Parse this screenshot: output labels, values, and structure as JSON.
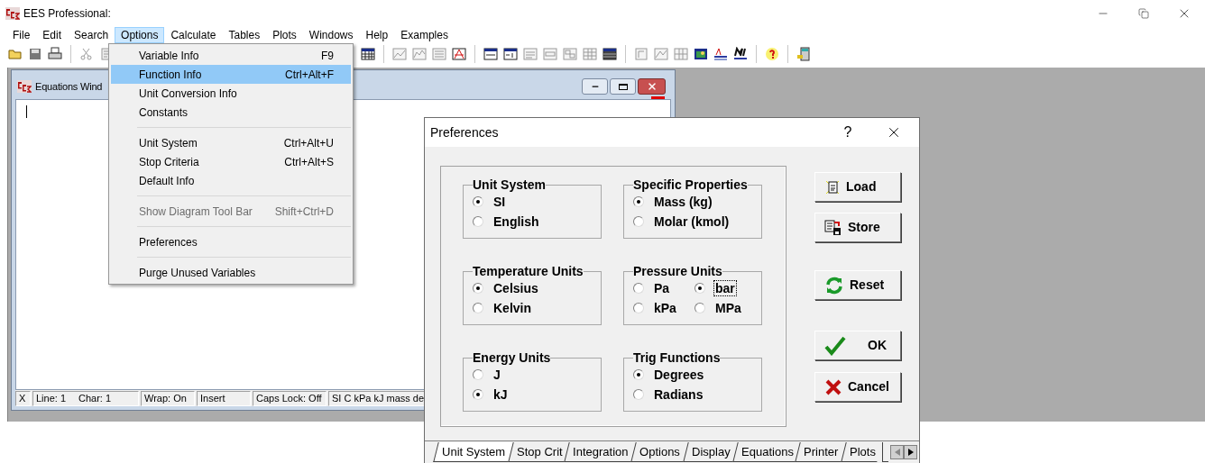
{
  "app": {
    "title": "EES Professional:"
  },
  "menu_bar": [
    {
      "label": "File",
      "selected": false
    },
    {
      "label": "Edit",
      "selected": false
    },
    {
      "label": "Search",
      "selected": false
    },
    {
      "label": "Options",
      "selected": true
    },
    {
      "label": "Calculate",
      "selected": false
    },
    {
      "label": "Tables",
      "selected": false
    },
    {
      "label": "Plots",
      "selected": false
    },
    {
      "label": "Windows",
      "selected": false
    },
    {
      "label": "Help",
      "selected": false
    },
    {
      "label": "Examples",
      "selected": false
    }
  ],
  "options_menu": [
    {
      "kind": "item",
      "label": "Variable Info",
      "shortcut": "F9",
      "selected": false,
      "disabled": false
    },
    {
      "kind": "item",
      "label": "Function Info",
      "shortcut": "Ctrl+Alt+F",
      "selected": true,
      "disabled": false
    },
    {
      "kind": "item",
      "label": "Unit Conversion Info",
      "selected": false,
      "disabled": false
    },
    {
      "kind": "item",
      "label": "Constants",
      "selected": false,
      "disabled": false
    },
    {
      "kind": "separator"
    },
    {
      "kind": "item",
      "label": "Unit System",
      "shortcut": "Ctrl+Alt+U",
      "selected": false,
      "disabled": false
    },
    {
      "kind": "item",
      "label": "Stop Criteria",
      "shortcut": "Ctrl+Alt+S",
      "selected": false,
      "disabled": false
    },
    {
      "kind": "item",
      "label": "Default Info",
      "selected": false,
      "disabled": false
    },
    {
      "kind": "separator"
    },
    {
      "kind": "item",
      "label": "Show Diagram Tool Bar",
      "shortcut": "Shift+Ctrl+D",
      "selected": false,
      "disabled": true
    },
    {
      "kind": "separator"
    },
    {
      "kind": "item",
      "label": "Preferences",
      "selected": false,
      "disabled": false
    },
    {
      "kind": "separator"
    },
    {
      "kind": "item",
      "label": "Purge Unused Variables",
      "selected": false,
      "disabled": false
    }
  ],
  "equations_window": {
    "title": "Equations Wind",
    "status_bar": [
      {
        "texts": [
          "X"
        ]
      },
      {
        "texts": [
          "Line: 1",
          "Char: 1"
        ]
      },
      {
        "texts": [
          "Wrap: On"
        ]
      },
      {
        "texts": [
          "Insert"
        ]
      },
      {
        "texts": [
          "Caps Lock: Off"
        ]
      },
      {
        "texts": [
          "SI C kPa kJ mass de"
        ]
      }
    ]
  },
  "preferences_dialog": {
    "title": "Preferences",
    "help": "?",
    "groups": [
      {
        "title": "Unit System",
        "options": [
          {
            "label": "SI",
            "selected": true,
            "focused": false
          },
          {
            "label": "English",
            "selected": false,
            "focused": false
          }
        ]
      },
      {
        "title": "Specific Properties",
        "options": [
          {
            "label": "Mass (kg)",
            "selected": true,
            "focused": false
          },
          {
            "label": "Molar (kmol)",
            "selected": false,
            "focused": false
          }
        ]
      },
      {
        "title": "Temperature Units",
        "options": [
          {
            "label": "Celsius",
            "selected": true,
            "focused": false
          },
          {
            "label": "Kelvin",
            "selected": false,
            "focused": false
          }
        ]
      },
      {
        "title": "Pressure Units",
        "options": [
          {
            "label": "Pa",
            "selected": false,
            "focused": false
          },
          {
            "label": "bar",
            "selected": true,
            "focused": true
          },
          {
            "label": "kPa",
            "selected": false,
            "focused": false
          },
          {
            "label": "MPa",
            "selected": false,
            "focused": false
          }
        ]
      },
      {
        "title": "Energy Units",
        "options": [
          {
            "label": "J",
            "selected": false,
            "focused": false
          },
          {
            "label": "kJ",
            "selected": true,
            "focused": false
          }
        ]
      },
      {
        "title": "Trig Functions",
        "options": [
          {
            "label": "Degrees",
            "selected": true,
            "focused": false
          },
          {
            "label": "Radians",
            "selected": false,
            "focused": false
          }
        ]
      }
    ],
    "buttons": [
      {
        "kind": "load",
        "label": "Load"
      },
      {
        "kind": "store",
        "label": "Store"
      },
      {
        "kind": "reset",
        "label": "Reset"
      },
      {
        "kind": "ok",
        "label": "OK"
      },
      {
        "kind": "cancel",
        "label": "Cancel"
      }
    ],
    "tabs": [
      {
        "label": "Unit System",
        "selected": true
      },
      {
        "label": "Stop Crit",
        "selected": false
      },
      {
        "label": "Integration",
        "selected": false
      },
      {
        "label": "Options",
        "selected": false
      },
      {
        "label": "Display",
        "selected": false
      },
      {
        "label": "Equations",
        "selected": false
      },
      {
        "label": "Printer",
        "selected": false
      },
      {
        "label": "Plots",
        "selected": false
      }
    ]
  }
}
